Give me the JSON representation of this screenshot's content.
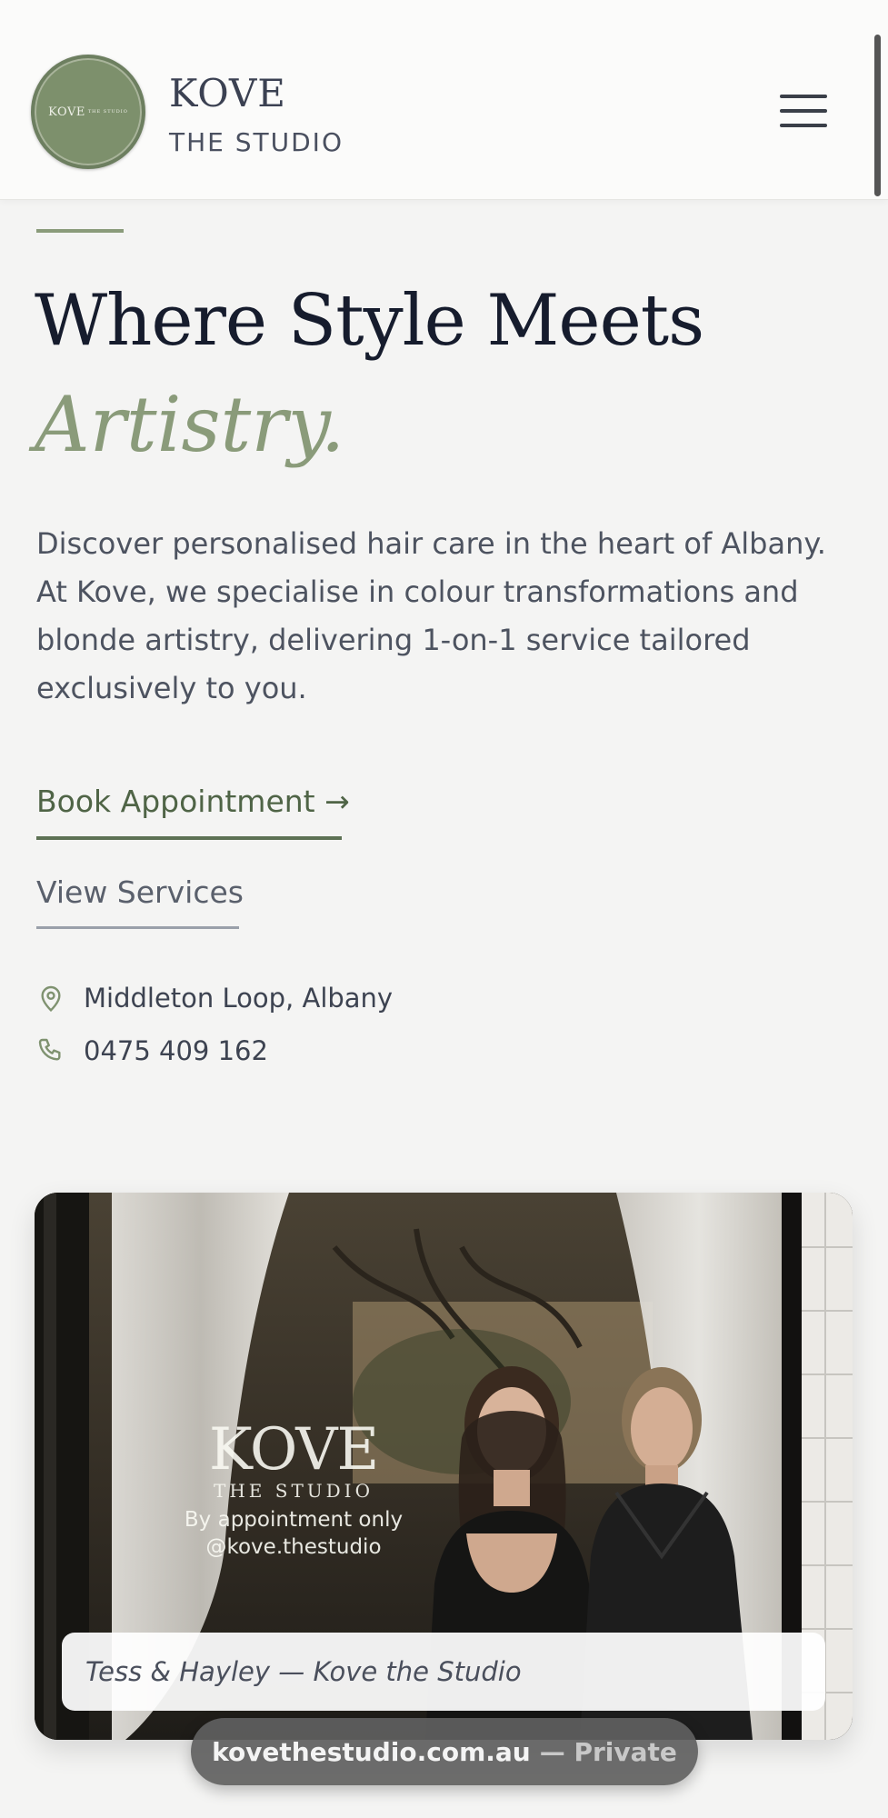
{
  "header": {
    "logo_circle_text": "KOVE",
    "logo_circle_sub": "THE STUDIO",
    "brand_name": "KOVE",
    "brand_sub": "THE STUDIO",
    "menu_icon": "hamburger-menu-icon"
  },
  "hero": {
    "headline": "Where Style Meets",
    "headline_accent": "Artistry.",
    "intro": "Discover personalised hair care in the heart of Albany. At Kove, we specialise in colour transformations and blonde artistry, delivering 1-on-1 service tailored exclusively to you.",
    "book_label": "Book Appointment →",
    "services_label": "View Services"
  },
  "contact": {
    "address": "Middleton Loop, Albany",
    "address_icon": "map-pin-icon",
    "phone": "0475 409 162",
    "phone_icon": "phone-icon"
  },
  "photo": {
    "window_brand": "KOVE",
    "window_sub": "THE STUDIO",
    "window_line1": "By appointment only",
    "window_line2": "@kove.thestudio",
    "caption": "Tess & Hayley — Kove the Studio"
  },
  "browser": {
    "domain": "kovethestudio.com.au",
    "mode": "— Private"
  },
  "colors": {
    "accent": "#8a9b7a",
    "button_green": "#4f6446",
    "background": "#f4f4f3"
  }
}
